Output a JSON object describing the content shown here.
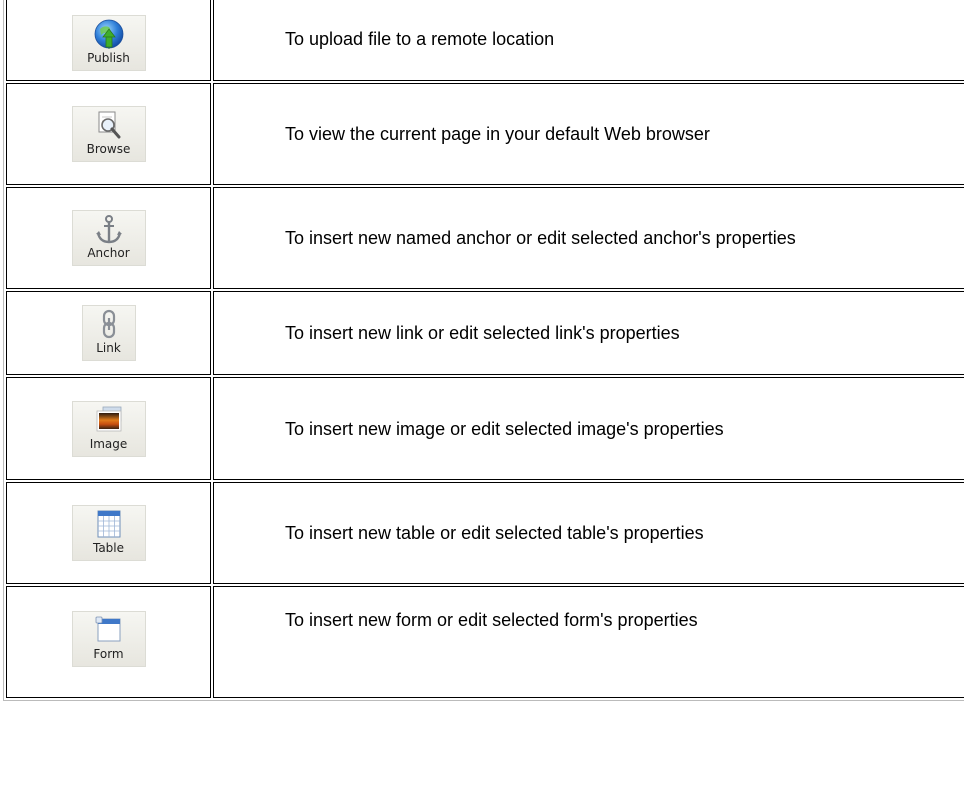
{
  "rows": [
    {
      "button_label": "Publish",
      "icon": "publish-globe-icon",
      "description": "To upload file to a remote location"
    },
    {
      "button_label": "Browse",
      "icon": "browse-magnifier-icon",
      "description": "To view the current page in your default Web browser"
    },
    {
      "button_label": "Anchor",
      "icon": "anchor-icon",
      "description": "To insert new named anchor or edit selected anchor's properties"
    },
    {
      "button_label": "Link",
      "icon": "link-chain-icon",
      "description": "To insert new link or edit selected link's properties"
    },
    {
      "button_label": "Image",
      "icon": "image-picture-icon",
      "description": "To insert new image or edit selected image's properties"
    },
    {
      "button_label": "Table",
      "icon": "table-grid-icon",
      "description": "To insert new table or edit selected table's properties"
    },
    {
      "button_label": "Form",
      "icon": "form-window-icon",
      "description": "To insert new form or edit selected form's properties"
    }
  ]
}
